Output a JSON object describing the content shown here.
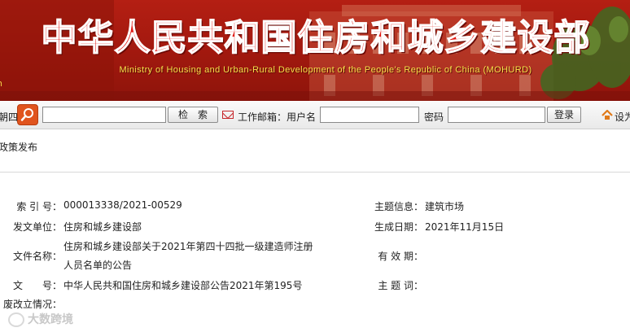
{
  "banner": {
    "title_cn": "中华人民共和国住房和城乡建设部",
    "title_en": "Ministry of Housing and Urban-Rural Development of the People's Republic of China (MOHURD)",
    "edge_text": "n"
  },
  "toolbar": {
    "left_fragment": "朝四",
    "search_value": "",
    "search_button": "检　索",
    "mail_label": "工作邮箱：用户名",
    "username_value": "",
    "password_label": "密码",
    "password_value": "",
    "login_button": "登录",
    "home_label": "设为"
  },
  "breadcrumb": {
    "text": "政策发布"
  },
  "info": {
    "index_label": "索 引 号：",
    "index_value": "000013338/2021-00529",
    "subject_info_label": "主题信息：",
    "subject_info_value": "建筑市场",
    "issuer_label": "发文单位：",
    "issuer_value": "住房和城乡建设部",
    "date_label": "生成日期：",
    "date_value": "2021年11月15日",
    "filename_label": "文件名称：",
    "filename_line1": "住房和城乡建设部关于2021年第四十四批一级建造师注册",
    "filename_line2": "人员名单的公告",
    "validity_label": "有 效 期：",
    "validity_value": "",
    "docno_label": "文　　号：",
    "docno_value": "中华人民共和国住房和城乡建设部公告2021年第195号",
    "theme_label": "主 题 词：",
    "theme_value": "",
    "status_label": "废改立情况：",
    "status_value": ""
  },
  "watermark": {
    "text": "大数跨境"
  },
  "colors": {
    "banner_red": "#a4190f",
    "title_red": "#e11a14",
    "en_yellow": "#f7e04a",
    "search_orange": "#e0541e"
  }
}
